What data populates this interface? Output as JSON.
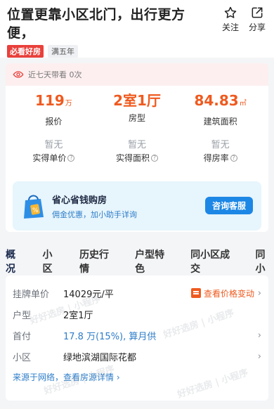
{
  "header": {
    "title": "位置更靠小区北门，出行更方便，",
    "follow_label": "关注",
    "share_label": "分享",
    "tag_must": "必看好房",
    "tag_years": "满五年"
  },
  "notice": {
    "text": "近七天带看 0次"
  },
  "metrics_main": [
    {
      "value": "119",
      "unit": "万",
      "label": "报价"
    },
    {
      "value": "2室1厅",
      "unit": "",
      "label": "房型"
    },
    {
      "value": "84.83",
      "unit": "㎡",
      "label": "建筑面积"
    }
  ],
  "metrics_sub": [
    {
      "value": "暂无",
      "label": "实得单价"
    },
    {
      "value": "暂无",
      "label": "实得面积"
    },
    {
      "value": "暂无",
      "label": "得房率"
    }
  ],
  "promo": {
    "title": "省心省钱购房",
    "subtitle": "佣金优惠，加小助手详询",
    "button": "咨询客服"
  },
  "tabs": [
    "概况",
    "小区",
    "历史行情",
    "户型特色",
    "同小区成交",
    "同小"
  ],
  "info": {
    "unit_price_label": "挂牌单价",
    "unit_price_value": "14029元/平",
    "view_price_label": "查看价格变动",
    "layout_label": "户型",
    "layout_value": "2室1厅",
    "downpay_label": "首付",
    "downpay_value": "17.8 万(15%), 算月供",
    "community_label": "小区",
    "community_value": "绿地滨湖国际花都",
    "footer_link": "来源于网络，查看房源详情 ›"
  },
  "watermark": "好好选房 | 小程序"
}
